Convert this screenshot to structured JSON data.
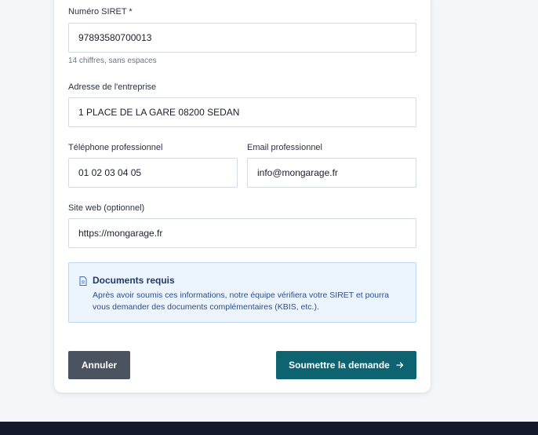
{
  "form": {
    "siret": {
      "label": "Numéro SIRET *",
      "value": "97893580700013",
      "hint": "14 chiffres, sans espaces"
    },
    "address": {
      "label": "Adresse de l'entreprise",
      "value": "1 PLACE DE LA GARE 08200 SEDAN"
    },
    "phone": {
      "label": "Téléphone professionnel",
      "value": "01 02 03 04 05"
    },
    "email": {
      "label": "Email professionnel",
      "value": "info@mongarage.fr"
    },
    "website": {
      "label": "Site web (optionnel)",
      "value": "https://mongarage.fr"
    }
  },
  "info": {
    "icon": "document-icon",
    "title": "Documents requis",
    "text": "Après avoir soumis ces informations, notre équipe vérifiera votre SIRET et pourra vous demander des documents complémentaires (KBIS, etc.)."
  },
  "actions": {
    "cancel_label": "Annuler",
    "submit_label": "Soumettre la demande",
    "submit_icon": "arrow-right-icon"
  },
  "colors": {
    "submit": "#0d6370",
    "cancel": "#4b5260",
    "info_bg": "#ecf4fd",
    "footer": "#141a2b"
  }
}
